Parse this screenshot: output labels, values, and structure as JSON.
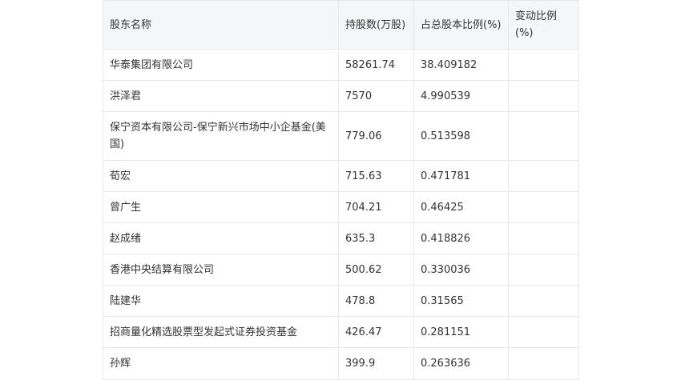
{
  "table": {
    "headers": [
      "股东名称",
      "持股数(万股)",
      "占总股本比例(%)",
      "变动比例(%)"
    ],
    "rows": [
      [
        "华泰集团有限公司",
        "58261.74",
        "38.409182",
        ""
      ],
      [
        "洪泽君",
        "7570",
        "4.990539",
        ""
      ],
      [
        "保宁资本有限公司-保宁新兴市场中小企基金(美国)",
        "779.06",
        "0.513598",
        ""
      ],
      [
        "荀宏",
        "715.63",
        "0.471781",
        ""
      ],
      [
        "曾广生",
        "704.21",
        "0.46425",
        ""
      ],
      [
        "赵成绪",
        "635.3",
        "0.418826",
        ""
      ],
      [
        "香港中央结算有限公司",
        "500.62",
        "0.330036",
        ""
      ],
      [
        "陆建华",
        "478.8",
        "0.31565",
        ""
      ],
      [
        "招商量化精选股票型发起式证券投资基金",
        "426.47",
        "0.281151",
        ""
      ],
      [
        "孙辉",
        "399.9",
        "0.263636",
        ""
      ]
    ]
  }
}
